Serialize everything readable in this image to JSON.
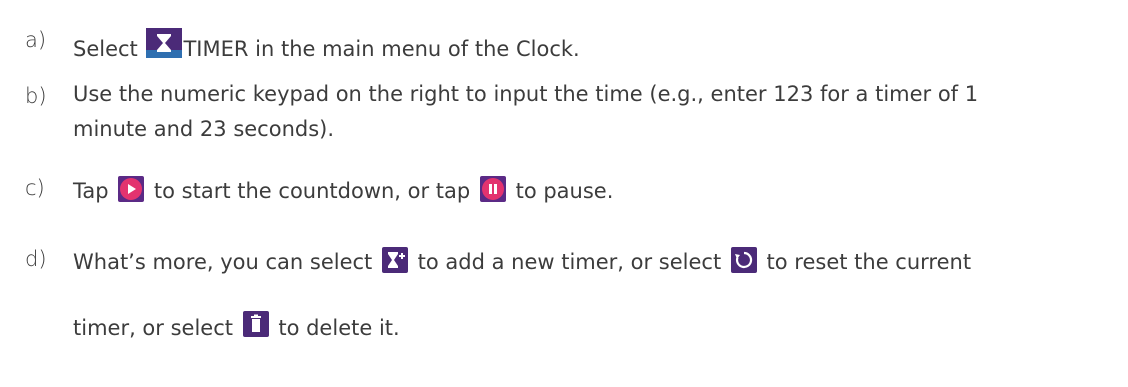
{
  "steps": [
    {
      "marker": "a)",
      "parts": [
        "Select ",
        "TIMER in the main menu of the Clock."
      ]
    },
    {
      "marker": "b)",
      "line1": "Use the numeric keypad on the right to input the time (e.g., enter 123 for a timer of 1",
      "line2": "minute and 23 seconds)."
    },
    {
      "marker": "c)",
      "parts": [
        "Tap ",
        " to start the countdown, or tap ",
        " to pause."
      ]
    },
    {
      "marker": "d)",
      "parts": [
        "What’s more, you can select ",
        " to add a new timer, or select ",
        " to reset the current"
      ],
      "line2_parts": [
        "timer, or select ",
        " to delete it."
      ]
    }
  ],
  "icons": {
    "timer": "hourglass-icon",
    "start": "play-icon",
    "pause": "pause-icon",
    "add_timer": "add-timer-icon",
    "reset": "reset-icon",
    "delete": "trash-icon"
  },
  "colors": {
    "text": "#3c3c3c",
    "icon_purple": "#5b2a86",
    "icon_pink": "#e3336f"
  }
}
